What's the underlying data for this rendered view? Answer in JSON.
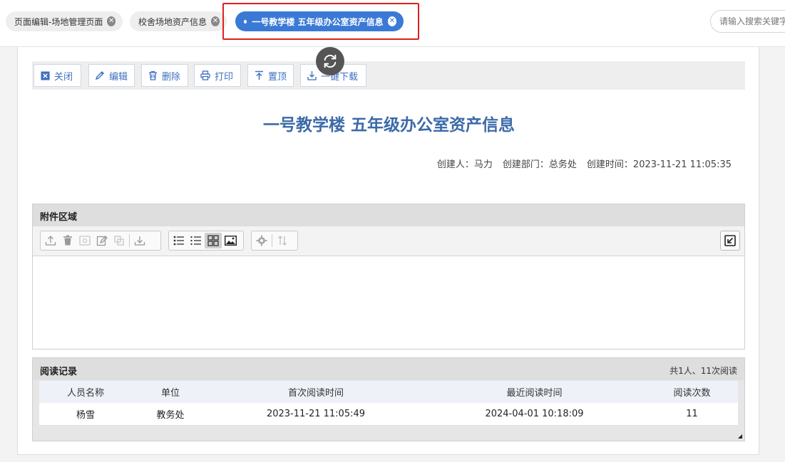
{
  "tabs": [
    {
      "label": "页面编辑-场地管理页面",
      "active": false
    },
    {
      "label": "校舍场地资产信息",
      "active": false
    },
    {
      "label": "一号教学楼 五年级办公室资产信息",
      "active": true
    }
  ],
  "search": {
    "placeholder": "请输入搜索关键字"
  },
  "toolbar": {
    "close_label": "关闭",
    "edit_label": "编辑",
    "delete_label": "删除",
    "print_label": "打印",
    "top_label": "置顶",
    "download_label": "一键下载"
  },
  "document": {
    "title": "一号教学楼 五年级办公室资产信息",
    "creator": "创建人：马力",
    "department": "创建部门：总务处",
    "created_time": "创建时间：2023-11-21 11:05:35"
  },
  "attachments": {
    "title": "附件区域"
  },
  "read_records": {
    "title": "阅读记录",
    "summary": "共1人、11次阅读",
    "columns": [
      "人员名称",
      "单位",
      "首次阅读时间",
      "最近阅读时间",
      "阅读次数"
    ],
    "rows": [
      [
        "杨雪",
        "教务处",
        "2023-11-21 11:05:49",
        "2024-04-01 10:18:09",
        "11"
      ]
    ]
  },
  "colors": {
    "accent": "#3a7ad6",
    "title": "#3c6aa8",
    "highlight": "#e02020"
  }
}
